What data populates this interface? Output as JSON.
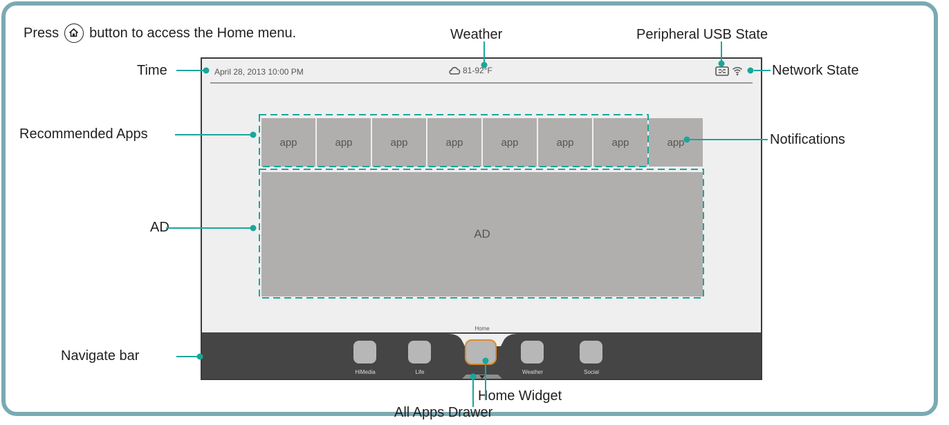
{
  "intro": {
    "before": "Press",
    "icon": "home-icon",
    "after": "button to access the Home menu."
  },
  "callouts": {
    "weather": "Weather",
    "usb": "Peripheral USB State",
    "time": "Time",
    "network": "Network State",
    "recommended": "Recommended Apps",
    "notifications": "Notifications",
    "ad": "AD",
    "navigate": "Navigate bar",
    "home_widget": "Home Widget",
    "all_apps": "All Apps Drawer"
  },
  "screen": {
    "date_time": "April 28, 2013 10:00 PM",
    "weather": "81-92°F",
    "weather_icon": "cloud-icon",
    "usb_icon": "usb-icon",
    "network_icon": "wifi-icon",
    "apps": [
      "app",
      "app",
      "app",
      "app",
      "app",
      "app",
      "app",
      "app"
    ],
    "ad_label": "AD",
    "nav": {
      "home_label": "Home",
      "items": [
        "HiMedia",
        "Life",
        "Weather",
        "Social"
      ]
    }
  },
  "colors": {
    "accent": "#1aa69a",
    "frame": "#7aaab2",
    "highlight": "#e08a2a",
    "tile": "#b0afae",
    "navbar": "#464545"
  }
}
